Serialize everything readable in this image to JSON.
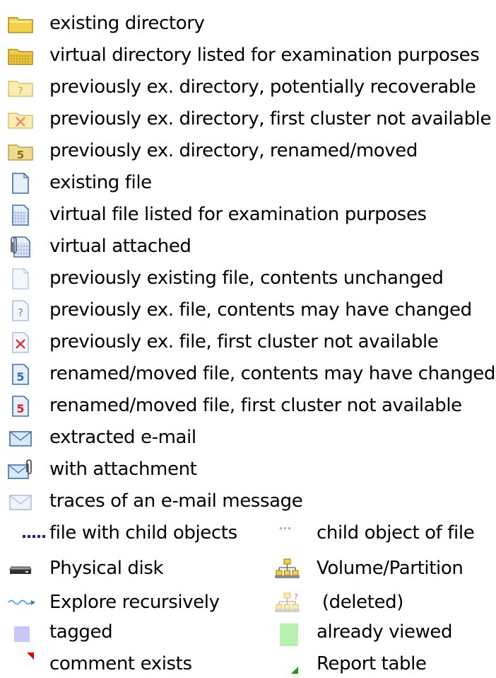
{
  "legend": {
    "items": [
      {
        "label": "existing directory",
        "icon": "folder-icon"
      },
      {
        "label": "virtual directory listed for examination purposes",
        "icon": "virtual-folder-icon"
      },
      {
        "label": "previously ex. directory, potentially recoverable",
        "icon": "folder-question-icon"
      },
      {
        "label": "previously ex. directory, first cluster not available",
        "icon": "folder-x-icon"
      },
      {
        "label": "previously ex. directory, renamed/moved",
        "icon": "folder-renamed-icon"
      },
      {
        "label": "existing file",
        "icon": "file-icon"
      },
      {
        "label": "virtual file listed for examination purposes",
        "icon": "virtual-file-icon"
      },
      {
        "label": "virtual attached",
        "icon": "virtual-attached-icon"
      },
      {
        "label": "previously existing file, contents unchanged",
        "icon": "faded-file-icon"
      },
      {
        "label": "previously ex. file, contents may have changed",
        "icon": "file-question-icon"
      },
      {
        "label": "previously ex. file, first cluster not available",
        "icon": "file-x-icon"
      },
      {
        "label": "renamed/moved file, contents may have changed",
        "icon": "file-renamed-blue-icon"
      },
      {
        "label": "renamed/moved file, first cluster not available",
        "icon": "file-renamed-red-icon"
      },
      {
        "label": "extracted e-mail",
        "icon": "email-icon"
      },
      {
        "label": "with attachment",
        "icon": "email-attachment-icon"
      },
      {
        "label": "traces of an e-mail message",
        "icon": "email-traces-icon"
      }
    ],
    "pairs": [
      {
        "left": {
          "label": "file with child objects",
          "icon": "dotted-line-dark-icon"
        },
        "right": {
          "label": "child object of file",
          "icon": "dotted-line-light-icon"
        }
      },
      {
        "left": {
          "label": "Physical disk",
          "icon": "disk-icon"
        },
        "right": {
          "label": "Volume/Partition",
          "icon": "volume-icon"
        }
      },
      {
        "left": {
          "label": "Explore recursively",
          "icon": "wave-arrow-icon"
        },
        "right": {
          "label": " (deleted)",
          "icon": "volume-deleted-icon"
        }
      },
      {
        "left": {
          "label": "tagged",
          "icon": "tagged-swatch-icon"
        },
        "right": {
          "label": "already viewed",
          "icon": "viewed-swatch-icon"
        }
      },
      {
        "left": {
          "label": "comment exists",
          "icon": "comment-marker-icon"
        },
        "right": {
          "label": "Report table",
          "icon": "report-marker-icon"
        }
      }
    ],
    "colors": {
      "folder": "#f2d04a",
      "file_outline": "#3a6fb8",
      "tagged": "#c8c8f8",
      "viewed": "#b8f0b0",
      "comment_marker": "#e00000",
      "report_marker": "#10a010"
    }
  }
}
